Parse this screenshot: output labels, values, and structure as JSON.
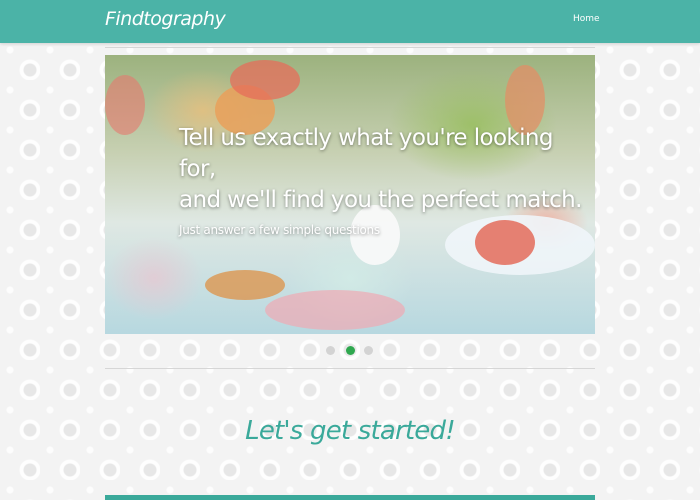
{
  "navbar": {
    "brand": "Findtography",
    "home_label": "Home",
    "color": "#4bb3a7"
  },
  "hero": {
    "headline_line1": "Tell us exactly what you're looking for,",
    "headline_line2": "and we'll find you the perfect match.",
    "subline": "Just answer a few simple questions"
  },
  "carousel": {
    "slide_count": 3,
    "active_index": 1,
    "active_color": "#2fa84f",
    "inactive_color": "#d3d3d3"
  },
  "cta": {
    "label": "Let's get started!",
    "color": "#3aa99a"
  }
}
